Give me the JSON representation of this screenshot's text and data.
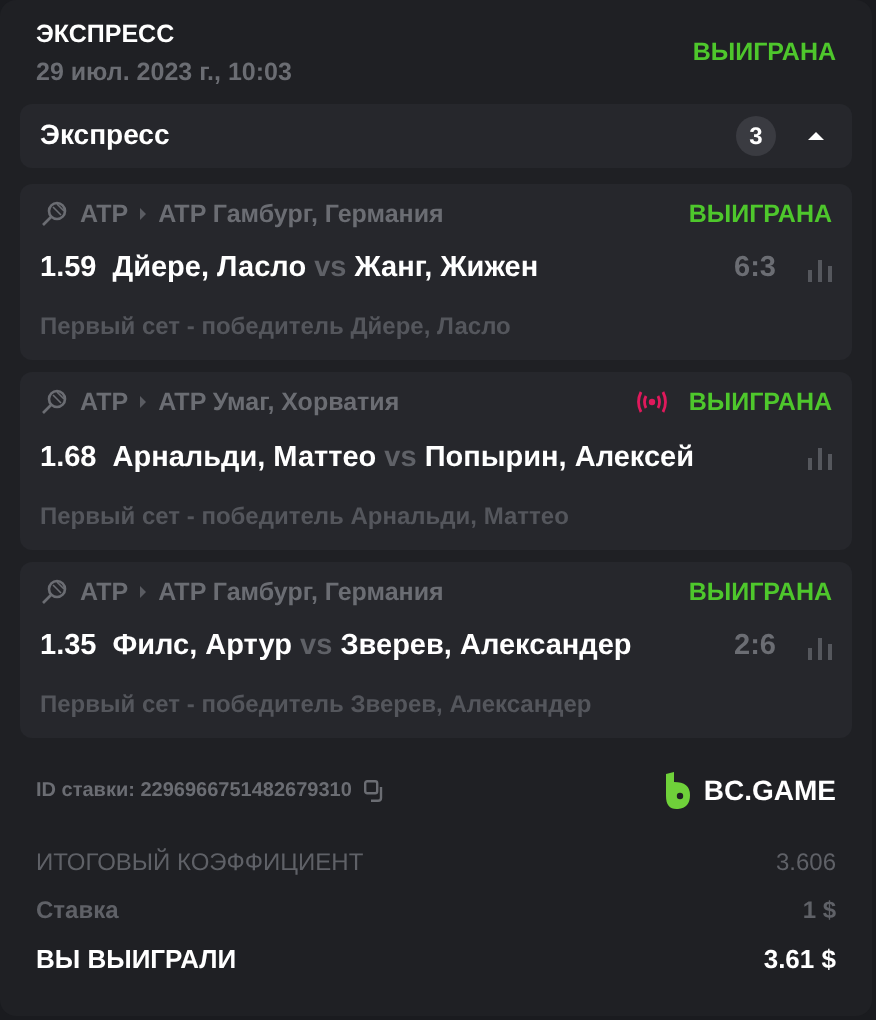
{
  "header": {
    "title": "ЭКСПРЕСС",
    "date": "29 июл. 2023 г., 10:03",
    "status": "ВЫИГРАНА"
  },
  "express": {
    "label": "Экспресс",
    "count": "3",
    "expanded": true
  },
  "events": [
    {
      "sport": "ATP",
      "tournament": "ATP Гамбург, Германия",
      "live": false,
      "status": "ВЫИГРАНА",
      "odds": "1.59",
      "home": "Дйере, Ласло",
      "vs": "vs",
      "away": "Жанг, Жижен",
      "score": "6:3",
      "market": "Первый сет - победитель Дйере, Ласло"
    },
    {
      "sport": "ATP",
      "tournament": "ATP Умаг, Хорватия",
      "live": true,
      "status": "ВЫИГРАНА",
      "odds": "1.68",
      "home": "Арнальди, Маттео",
      "vs": "vs",
      "away": "Попырин, Алексей",
      "market": "Первый сет - победитель Арнальди, Маттео"
    },
    {
      "sport": "ATP",
      "tournament": "ATP Гамбург, Германия",
      "live": false,
      "status": "ВЫИГРАНА",
      "odds": "1.35",
      "home": "Филс, Артур",
      "vs": "vs",
      "away": "Зверев, Александер",
      "score": "2:6",
      "market": "Первый сет - победитель Зверев, Александер"
    }
  ],
  "footer": {
    "bet_id": "ID ставки: 2296966751482679310",
    "brand": "BC.GAME"
  },
  "totals": [
    {
      "kind": "muted",
      "label": "ИТОГОВЫЙ КОЭФФИЦИЕНТ",
      "value": "3.606"
    },
    {
      "kind": "muted",
      "label": "Ставка",
      "value": "1 $"
    },
    {
      "kind": "strong",
      "label": "ВЫ ВЫИГРАЛИ",
      "value": "3.61 $"
    }
  ]
}
